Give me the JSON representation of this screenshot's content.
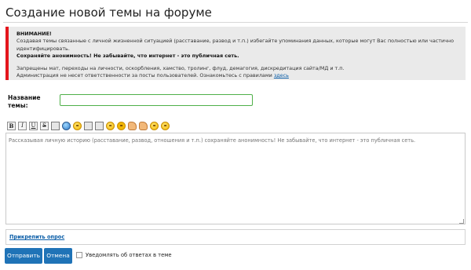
{
  "page": {
    "title": "Создание новой темы на форуме"
  },
  "warning": {
    "heading": "ВНИМАНИЕ!",
    "line1": "Создавая темы связанные с личной жизненной ситуацией (расставание, развод и т.п.) избегайте упоминания данных, которые могут Вас полностью или частично идентифицировать.",
    "line2": "Сохраняйте анонимность! Не забывайте, что интернет - это публичная сеть.",
    "line3": "Запрещены мат, переходы на личности, оскорбления, хамство, тролинг, флуд, демагогия, дискредитация сайта/МД и т.п.",
    "line4": "Администрация не несет ответственности за посты пользователей. Ознакомьтесь с правилами",
    "rules_link": "здесь",
    "accent_color": "#e4151c"
  },
  "form": {
    "title_label": "Название темы:",
    "title_value": "",
    "editor_placeholder": "Рассказывая личную историю (расставание, развод, отношения и т.п.) сохраняйте анонимность! Не забывайте, что интернет - это публичная сеть.",
    "poll_link": "Прикрепить опрос",
    "notify_label": "Уведомлять об ответах в теме",
    "notify_checked": false
  },
  "toolbar": {
    "bold": "B",
    "italic": "I",
    "underline": "U",
    "strike": "S",
    "icons": [
      "bold-icon",
      "italic-icon",
      "underline-icon",
      "strike-icon",
      "quote-icon",
      "link-icon",
      "smiley-icon",
      "image-icon",
      "video-icon",
      "smile-icon",
      "cool-icon",
      "thumbs-up-icon",
      "wave-icon",
      "happy-icon",
      "grin-icon"
    ]
  },
  "buttons": {
    "submit": "Отправить",
    "cancel": "Отмена",
    "primary_color": "#1f73b7"
  }
}
